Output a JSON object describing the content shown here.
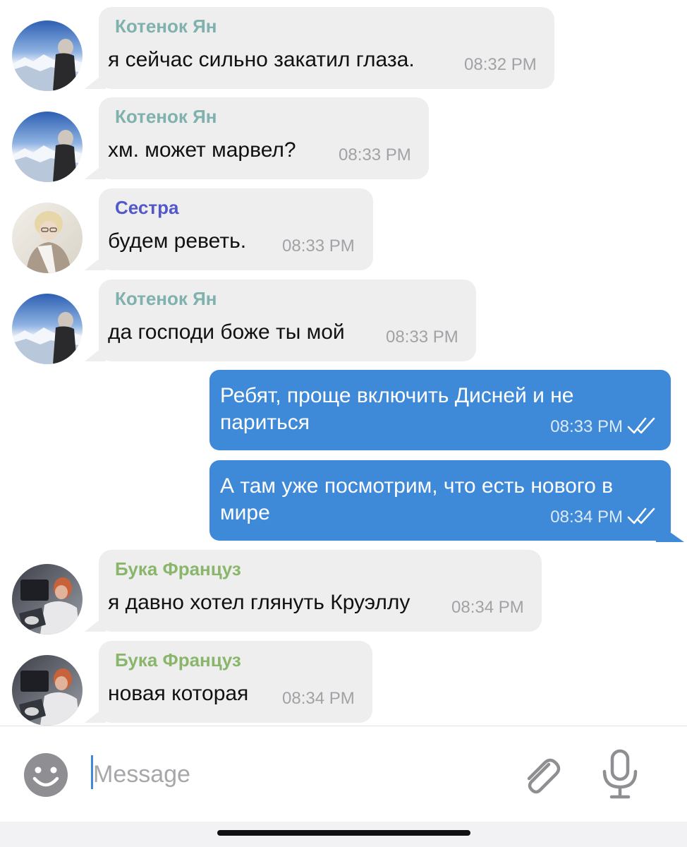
{
  "colors": {
    "incoming_bubble": "#eeeeef",
    "outgoing_bubble": "#3f8ad8",
    "sender_yan": "#7fb1ad",
    "sender_sestra": "#5258c9",
    "sender_buka": "#8ab66b",
    "time_incoming": "#a2a2a6",
    "accent": "#3f8ad8"
  },
  "messages": [
    {
      "sender": "Котенок Ян",
      "text": "я сейчас сильно закатил глаза.",
      "time": "08:32 PM"
    },
    {
      "sender": "Котенок Ян",
      "text": "хм. может марвел?",
      "time": "08:33 PM"
    },
    {
      "sender": "Сестра",
      "text": "будем реветь.",
      "time": "08:33 PM"
    },
    {
      "sender": "Котенок Ян",
      "text": "да господи боже ты мой",
      "time": "08:33 PM"
    },
    {
      "text": "Ребят, проще включить Дисней и не париться",
      "time": "08:33 PM",
      "status_icon": "double-check-icon"
    },
    {
      "text": "А там уже посмотрим, что есть нового в мире",
      "time": "08:34 PM",
      "status_icon": "double-check-icon"
    },
    {
      "sender": "Бука Француз",
      "text": "я давно хотел глянуть Круэллу",
      "time": "08:34 PM"
    },
    {
      "sender": "Бука Француз",
      "text": "новая которая",
      "time": "08:34 PM"
    }
  ],
  "composer": {
    "placeholder": "Message",
    "emoji_icon": "smile-icon",
    "attach_icon": "paperclip-icon",
    "mic_icon": "microphone-icon"
  }
}
